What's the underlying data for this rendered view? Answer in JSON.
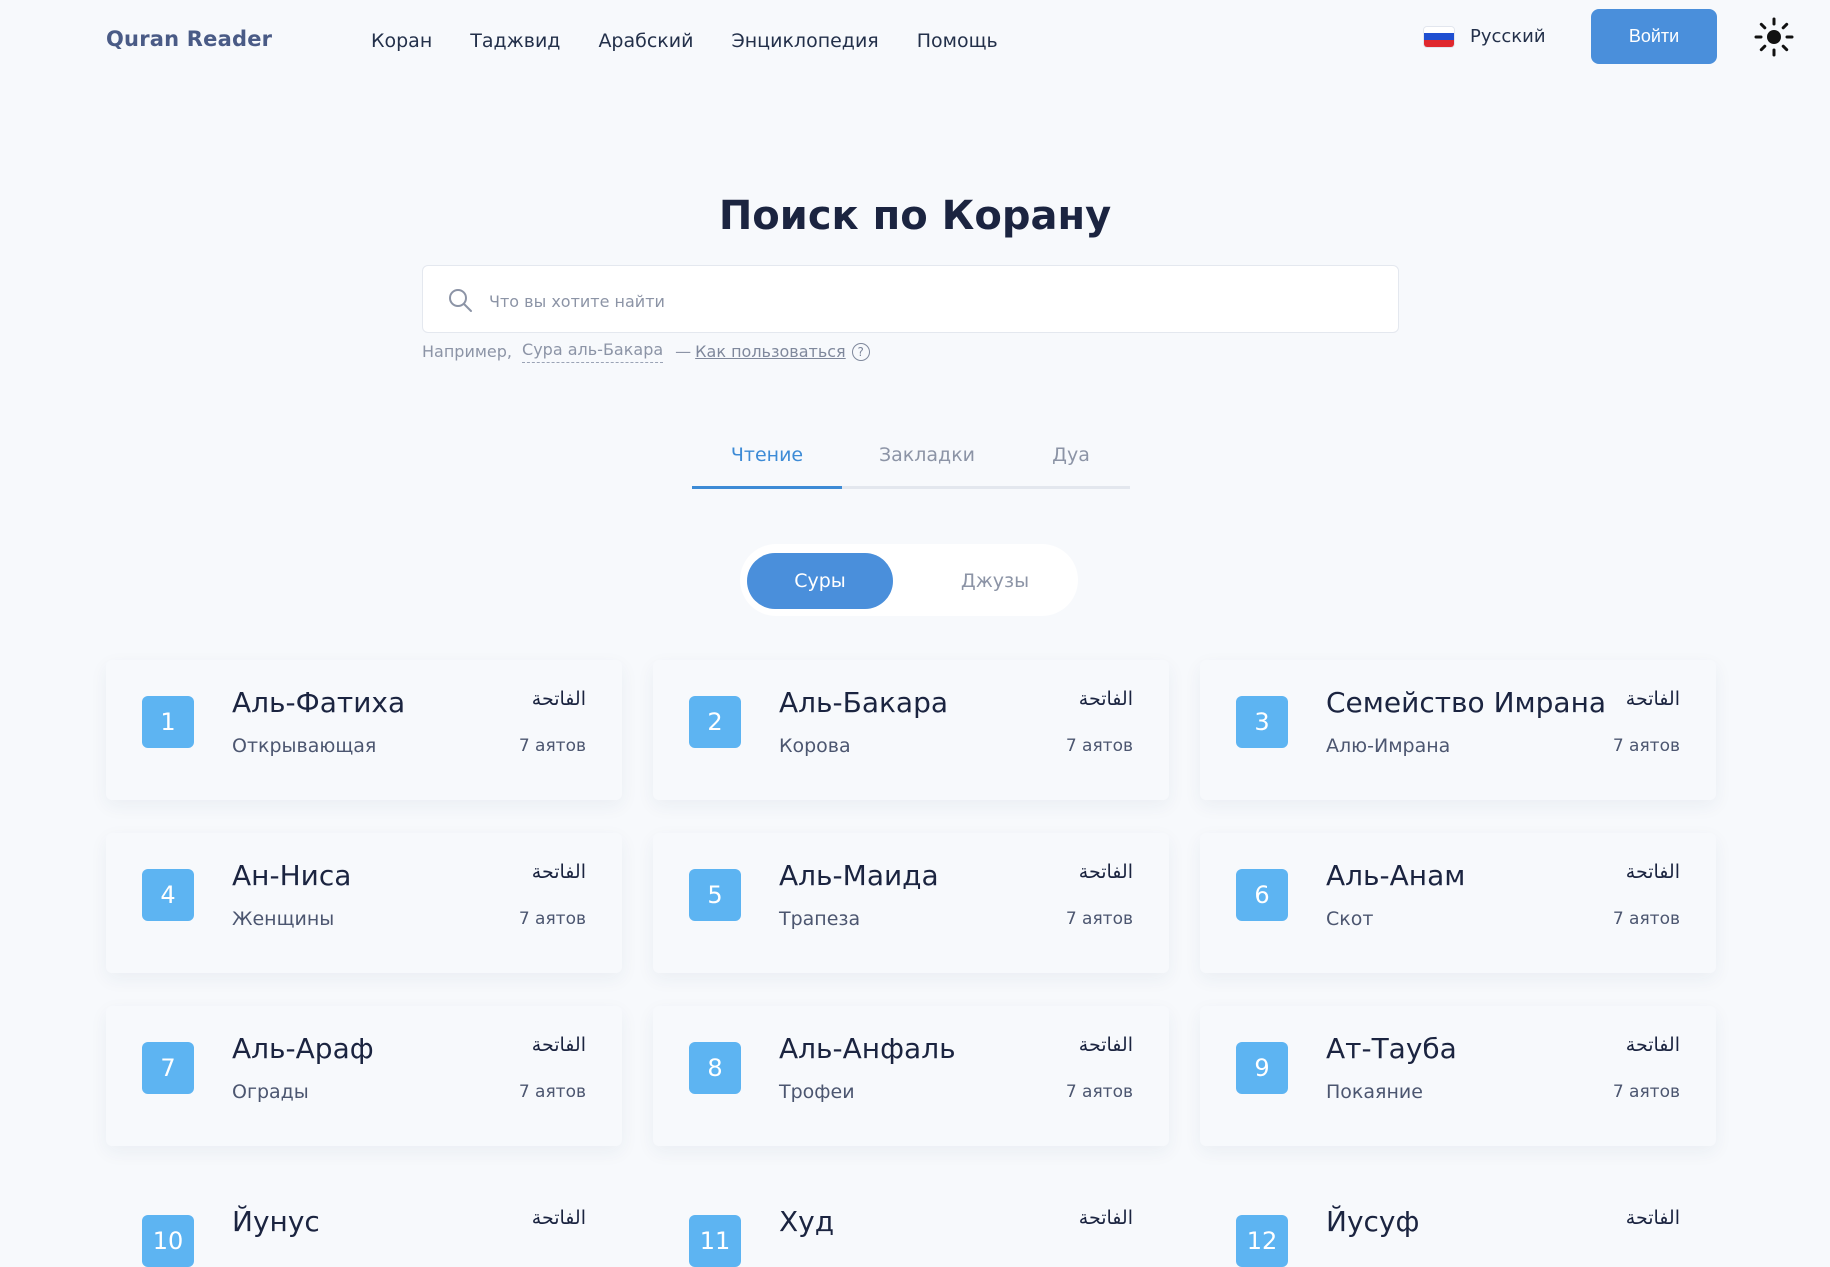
{
  "header": {
    "brand": "Quran Reader",
    "nav": [
      "Коран",
      "Таджвид",
      "Арабский",
      "Энциклопедия",
      "Помощь"
    ],
    "language": "Русский",
    "login": "Войти",
    "theme_icon": "sun-icon"
  },
  "hero": {
    "title": "Поиск по Корану",
    "search_placeholder": "Что вы хотите найти",
    "hint_prefix": "Например,",
    "hint_example": "Сура аль-Бакара",
    "hint_dash": "—",
    "hint_link": "Как пользоваться",
    "help_symbol": "?"
  },
  "tabs": [
    "Чтение",
    "Закладки",
    "Дуа"
  ],
  "toggle": [
    "Суры",
    "Джузы"
  ],
  "colors": {
    "accent": "#4a8fdb",
    "badge": "#5db4f2",
    "background": "#f7f9fc"
  },
  "surahs": [
    {
      "number": "1",
      "name": "Аль-Фатиха",
      "translation": "Открывающая",
      "arabic": "الفاتحة",
      "ayat": "7 аятов"
    },
    {
      "number": "2",
      "name": "Аль-Бакара",
      "translation": "Корова",
      "arabic": "الفاتحة",
      "ayat": "7 аятов"
    },
    {
      "number": "3",
      "name": "Семейство Имрана",
      "translation": "Алю-Имрана",
      "arabic": "الفاتحة",
      "ayat": "7 аятов"
    },
    {
      "number": "4",
      "name": "Ан-Ниса",
      "translation": "Женщины",
      "arabic": "الفاتحة",
      "ayat": "7 аятов"
    },
    {
      "number": "5",
      "name": "Аль-Маида",
      "translation": "Трапеза",
      "arabic": "الفاتحة",
      "ayat": "7 аятов"
    },
    {
      "number": "6",
      "name": "Аль-Анам",
      "translation": "Скот",
      "arabic": "الفاتحة",
      "ayat": "7 аятов"
    },
    {
      "number": "7",
      "name": "Аль-Араф",
      "translation": "Ограды",
      "arabic": "الفاتحة",
      "ayat": "7 аятов"
    },
    {
      "number": "8",
      "name": "Аль-Анфаль",
      "translation": "Трофеи",
      "arabic": "الفاتحة",
      "ayat": "7 аятов"
    },
    {
      "number": "9",
      "name": "Ат-Тауба",
      "translation": "Покаяние",
      "arabic": "الفاتحة",
      "ayat": "7 аятов"
    },
    {
      "number": "10",
      "name": "Йунус",
      "translation": "",
      "arabic": "الفاتحة",
      "ayat": ""
    },
    {
      "number": "11",
      "name": "Худ",
      "translation": "",
      "arabic": "الفاتحة",
      "ayat": ""
    },
    {
      "number": "12",
      "name": "Йусуф",
      "translation": "",
      "arabic": "الفاتحة",
      "ayat": ""
    }
  ]
}
